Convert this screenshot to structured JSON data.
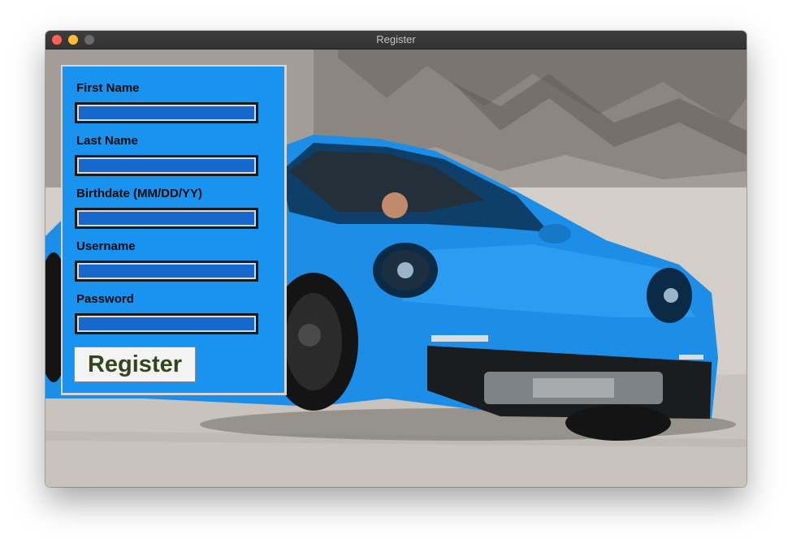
{
  "window": {
    "title": "Register"
  },
  "form": {
    "fields": [
      {
        "label": "First Name",
        "value": "",
        "placeholder": ""
      },
      {
        "label": "Last Name",
        "value": "",
        "placeholder": ""
      },
      {
        "label": "Birthdate (MM/DD/YY)",
        "value": "",
        "placeholder": ""
      },
      {
        "label": "Username",
        "value": "",
        "placeholder": ""
      },
      {
        "label": "Password",
        "value": "",
        "placeholder": ""
      }
    ],
    "submit_label": "Register"
  },
  "colors": {
    "panel_bg": "#1893f0",
    "field_bg": "#1668cd",
    "button_text": "#34451b",
    "car_body": "#1c8ee8"
  },
  "icons": {
    "close": "close-dot-icon",
    "minimize": "minimize-dot-icon",
    "maximize": "maximize-dot-icon"
  }
}
